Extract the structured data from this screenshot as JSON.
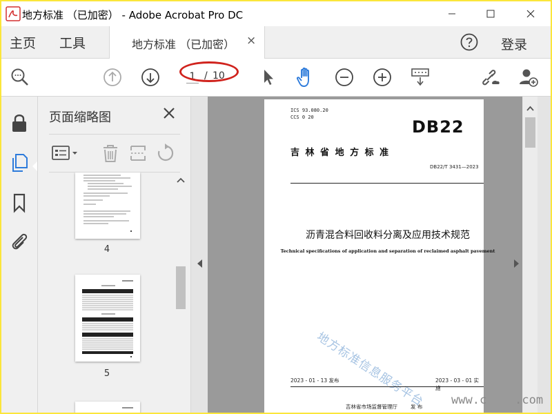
{
  "window": {
    "title": "地方标准 （已加密） - Adobe Acrobat Pro DC",
    "logo_text": "标准"
  },
  "tabbar": {
    "home_label": "主页",
    "tools_label": "工具",
    "doc_tab_label": "地方标准 （已加密）",
    "close_symbol": "×",
    "login_label": "登录"
  },
  "toolbar": {
    "current_page": "1",
    "page_separator": "/",
    "total_pages": "10",
    "icons": [
      "magnifier-icon",
      "page-up-icon",
      "page-down-icon",
      "select-arrow-icon",
      "hand-tool-icon",
      "zoom-out-icon",
      "zoom-in-icon",
      "marquee-zoom-icon",
      "share-link-icon",
      "add-user-icon"
    ]
  },
  "side_panel": {
    "title": "页面缩略图",
    "thumbnails": [
      {
        "label": "4"
      },
      {
        "label": "5"
      }
    ]
  },
  "document": {
    "ics": "ICS  93.080.20",
    "ccs": "CCS  0  20",
    "standard_code": "DB22",
    "issuer": "吉 林 省 地 方 标 准",
    "number": "DB22/T 3431—2023",
    "title_cn": "沥青混合料回收料分离及应用技术规范",
    "title_en": "Technical specifications of application and separation of reclaimed asphalt pavement",
    "watermark": "地方标准信息服务平台",
    "issue_date": "2023 - 01 - 13 发布",
    "effective_date": "2023 - 03 - 01 实施",
    "publisher": "吉林省市场监督管理厅",
    "publish_label": "发 布"
  },
  "site_watermark": "www.c    .com",
  "colors": {
    "accent_blue": "#2d7bdb",
    "annotation_red": "#d0231d",
    "frame_yellow": "#fbe63a"
  }
}
